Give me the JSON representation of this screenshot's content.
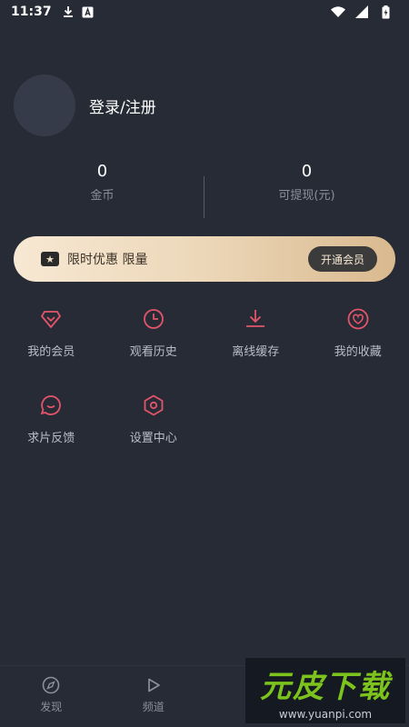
{
  "status_bar": {
    "time": "11:37"
  },
  "profile": {
    "login_label": "登录/注册"
  },
  "stats": [
    {
      "value": "0",
      "label": "金币"
    },
    {
      "value": "0",
      "label": "可提现(元)"
    }
  ],
  "vip_banner": {
    "text": "限时优惠 限量",
    "button_label": "开通会员"
  },
  "menu": [
    {
      "label": "我的会员",
      "icon": "diamond-icon"
    },
    {
      "label": "观看历史",
      "icon": "clock-icon"
    },
    {
      "label": "离线缓存",
      "icon": "download-icon"
    },
    {
      "label": "我的收藏",
      "icon": "heart-icon"
    },
    {
      "label": "求片反馈",
      "icon": "chat-icon"
    },
    {
      "label": "设置中心",
      "icon": "settings-icon"
    }
  ],
  "bottom_nav": [
    {
      "label": "发现",
      "icon": "compass-icon"
    },
    {
      "label": "频道",
      "icon": "play-icon"
    }
  ],
  "watermark": {
    "logo": "元皮下载",
    "url": "www.yuanpi.com"
  },
  "colors": {
    "accent": "#e2556b",
    "background": "#272b35",
    "gold": "#ecd7b8"
  }
}
